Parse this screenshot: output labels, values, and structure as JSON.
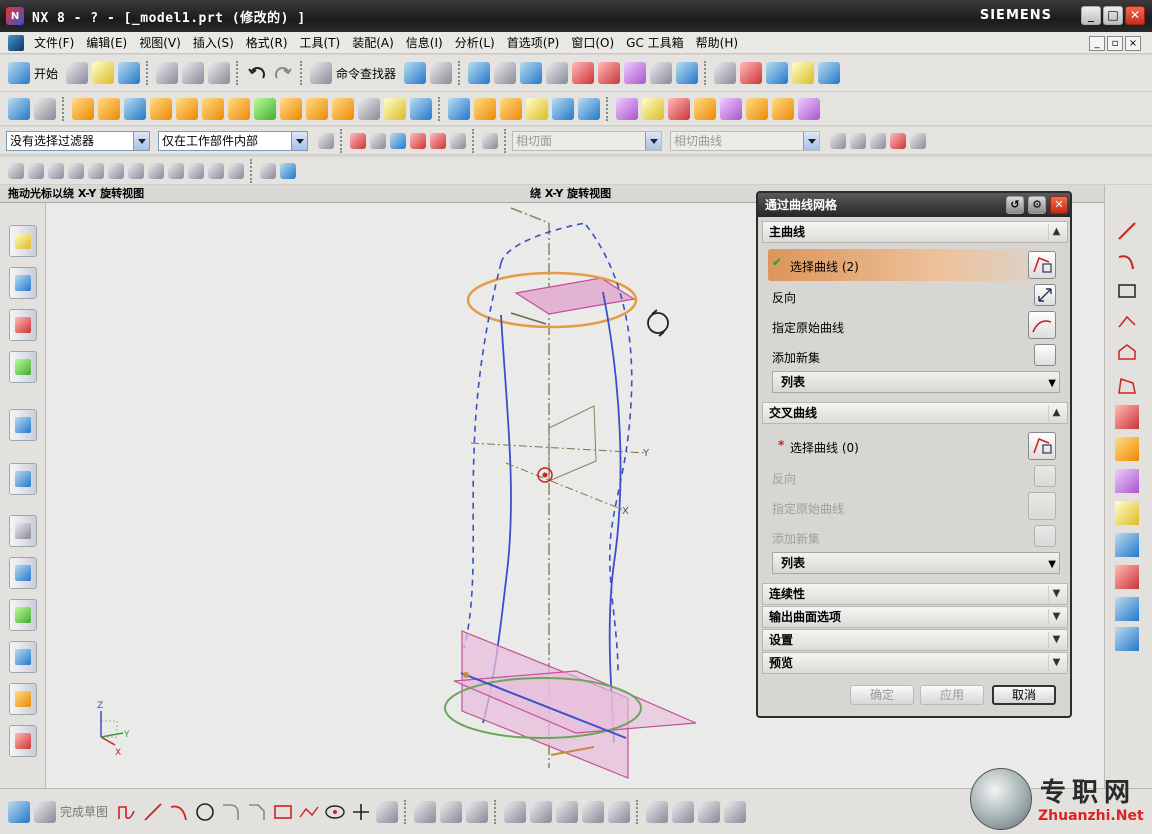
{
  "window": {
    "title": "NX 8 - ? - [_model1.prt  (修改的) ]",
    "brand": "SIEMENS",
    "min": "_",
    "max": "□",
    "close": "✕"
  },
  "menu": [
    "文件(F)",
    "编辑(E)",
    "视图(V)",
    "插入(S)",
    "格式(R)",
    "工具(T)",
    "装配(A)",
    "信息(I)",
    "分析(L)",
    "首选项(P)",
    "窗口(O)",
    "GC 工具箱",
    "帮助(H)"
  ],
  "toolbar": {
    "start_label": "开始",
    "command_finder_label": "命令查找器"
  },
  "filter": {
    "selection_filter": "没有选择过滤器",
    "scope": "仅在工作部件内部",
    "intersect_face": "相切面",
    "tangent_curve": "相切曲线"
  },
  "view_header": {
    "left": "拖动光标以绕 X-Y 旋转视图",
    "right": "绕 X-Y 旋转视图"
  },
  "dialog": {
    "title": "通过曲线网格",
    "primary": {
      "header": "主曲线",
      "select_curve": "选择曲线 (2)",
      "reverse": "反向",
      "specify_origin": "指定原始曲线",
      "add_new_set": "添加新集",
      "list": "列表"
    },
    "cross": {
      "header": "交叉曲线",
      "required_mark": "*",
      "select_curve": "选择曲线 (0)",
      "reverse": "反向",
      "specify_origin": "指定原始曲线",
      "add_new_set": "添加新集",
      "list": "列表"
    },
    "collapsed_sections": [
      "连续性",
      "输出曲面选项",
      "设置",
      "预览"
    ],
    "buttons": {
      "ok": "确定",
      "apply": "应用",
      "cancel": "取消"
    }
  },
  "bottom": {
    "finish_sketch": "完成草图"
  },
  "viewport": {
    "axis_labels": {
      "x": "X",
      "y": "Y",
      "z": "Z"
    }
  },
  "watermark": {
    "cn": "专职网",
    "en": "Zhuanzhi.Net"
  },
  "colors": {
    "curve_blue": "#3a4fc9",
    "section_orange": "#e59a45",
    "plane_pink": "#d77fb4",
    "ellipse_green": "#6aa65a",
    "accent_highlight": "#dc955a"
  }
}
